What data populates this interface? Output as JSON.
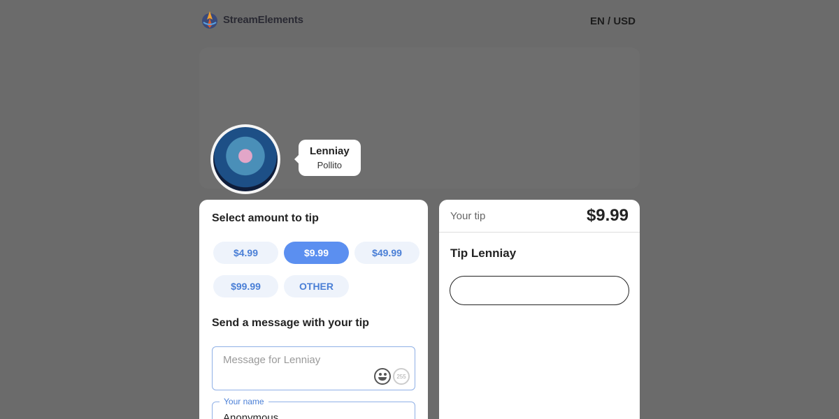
{
  "header": {
    "logo_text": "StreamElements",
    "locale": "EN / USD"
  },
  "profile": {
    "name": "Lenniay",
    "subtitle": "Pollito"
  },
  "tip_form": {
    "title": "Select amount to tip",
    "amounts": [
      {
        "label": "$4.99",
        "active": false
      },
      {
        "label": "$9.99",
        "active": true
      },
      {
        "label": "$49.99",
        "active": false
      },
      {
        "label": "$99.99",
        "active": false
      },
      {
        "label": "OTHER",
        "active": false
      }
    ],
    "message_title": "Send a message with your tip",
    "message_placeholder": "Message for Lenniay",
    "char_count": "255",
    "name_label": "Your name",
    "name_value": "Anonymous"
  },
  "summary": {
    "label": "Your tip",
    "amount": "$9.99",
    "title": "Tip Lenniay"
  },
  "colors": {
    "accent": "#5b8ff0",
    "background": "#6b6b6b"
  }
}
